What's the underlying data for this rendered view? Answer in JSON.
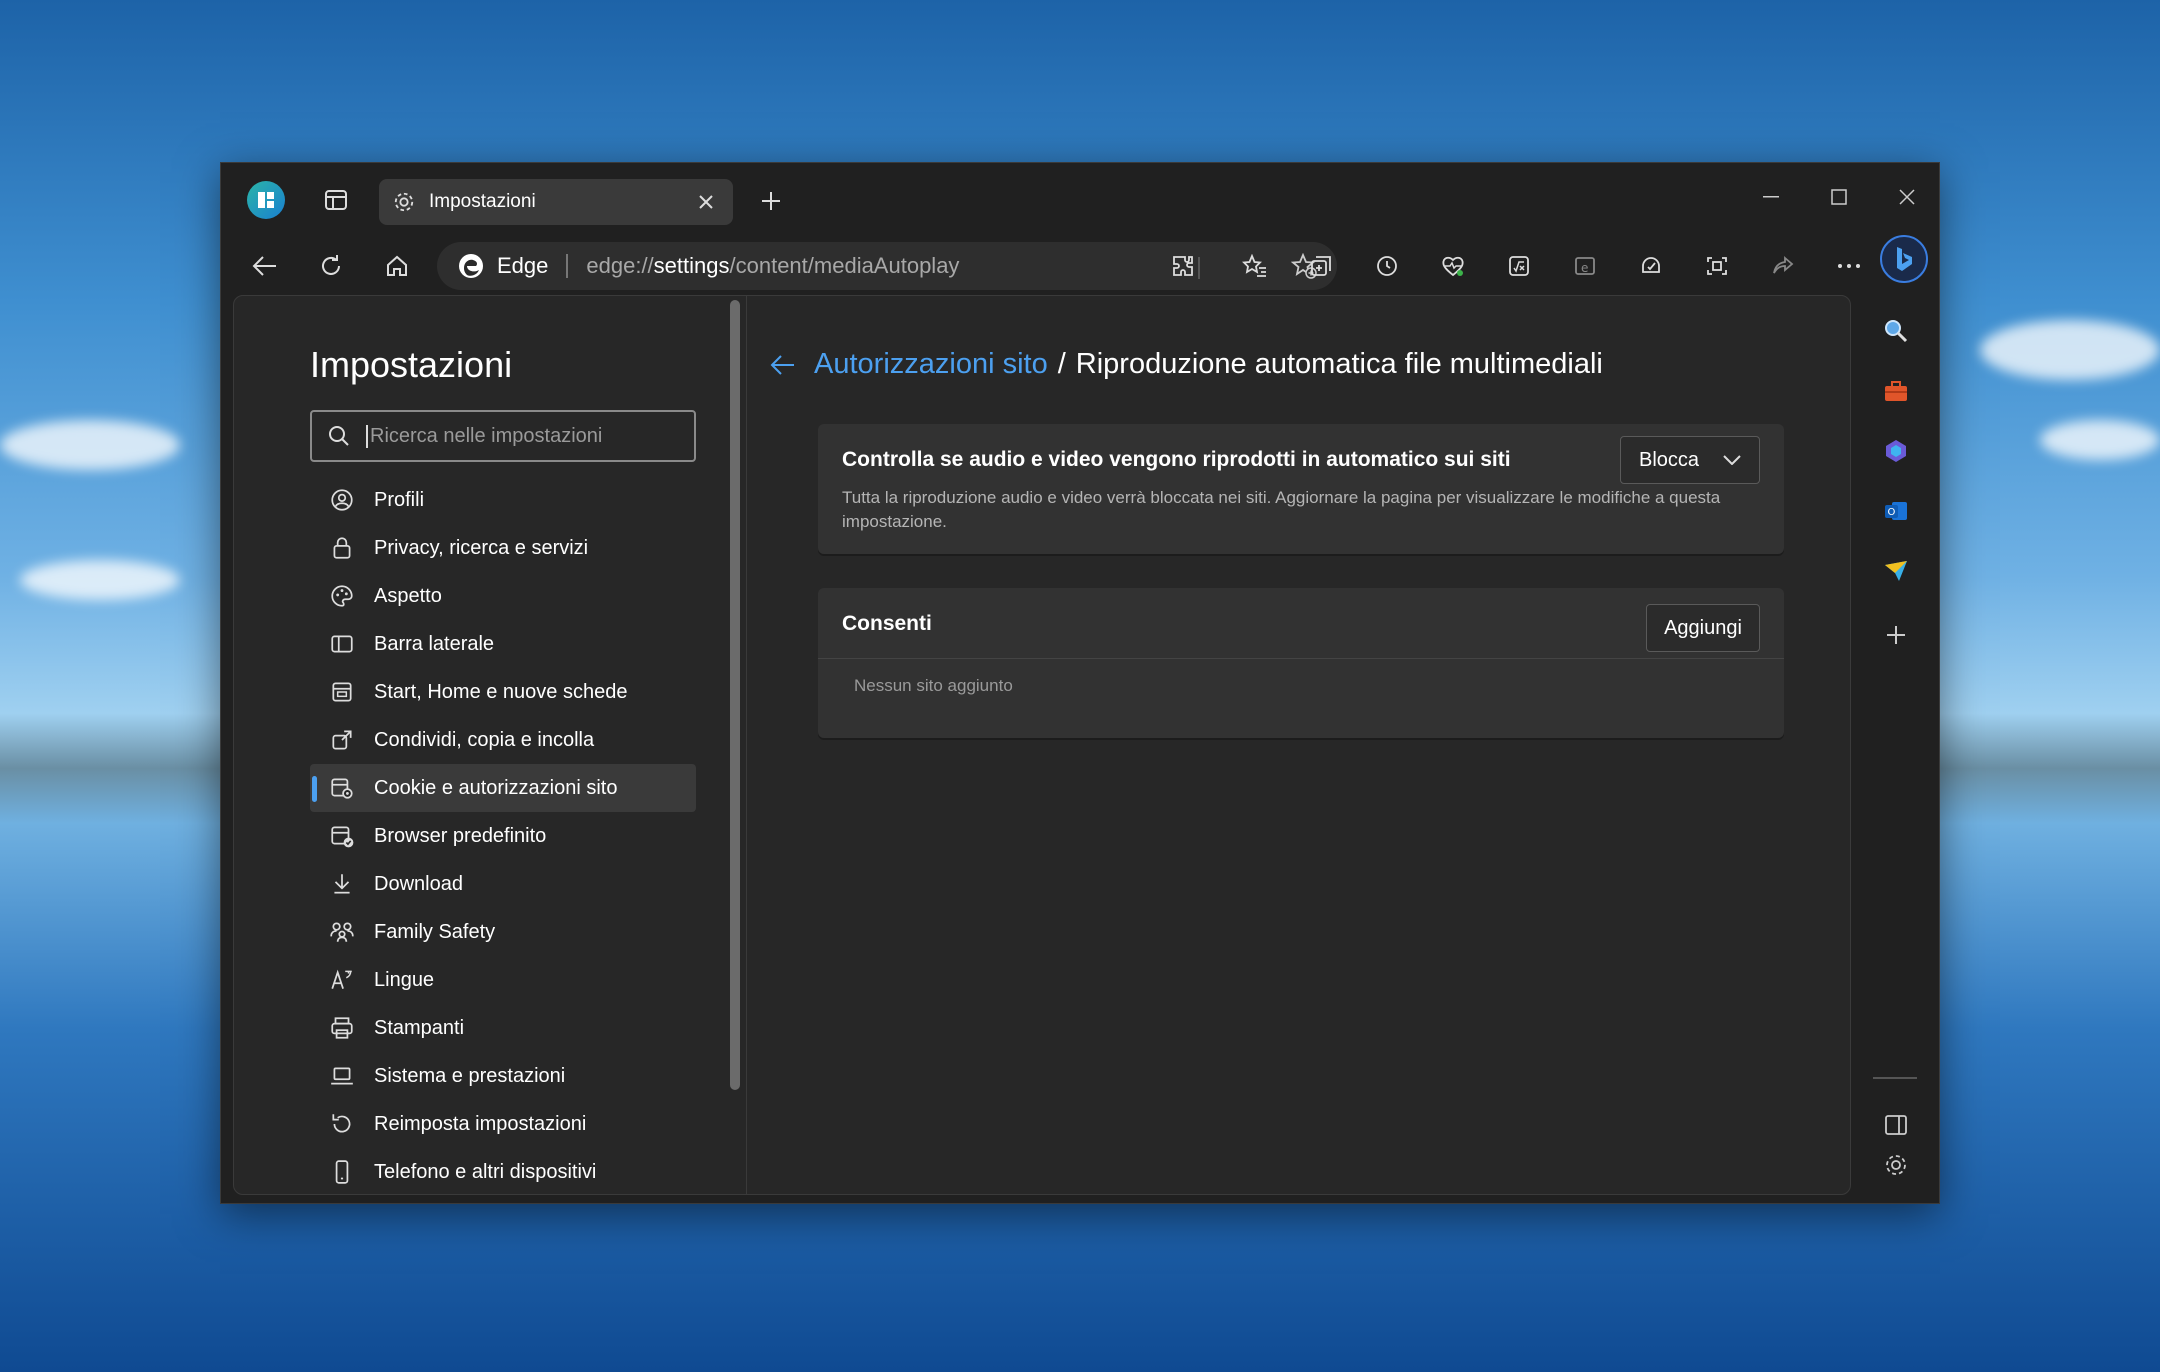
{
  "browser": {
    "tab_title": "Impostazioni",
    "address": {
      "brand": "Edge",
      "url_prefix": "edge://",
      "url_host": "settings",
      "url_path": "/content/mediaAutoplay"
    }
  },
  "settings": {
    "title": "Impostazioni",
    "search_placeholder": "Ricerca nelle impostazioni",
    "nav": [
      {
        "label": "Profili",
        "icon": "profile-icon"
      },
      {
        "label": "Privacy, ricerca e servizi",
        "icon": "lock-icon"
      },
      {
        "label": "Aspetto",
        "icon": "palette-icon"
      },
      {
        "label": "Barra laterale",
        "icon": "sidebar-icon"
      },
      {
        "label": "Start, Home e nuove schede",
        "icon": "home-tabs-icon"
      },
      {
        "label": "Condividi, copia e incolla",
        "icon": "share-icon"
      },
      {
        "label": "Cookie e autorizzazioni sito",
        "icon": "cookie-permissions-icon",
        "active": true
      },
      {
        "label": "Browser predefinito",
        "icon": "default-browser-icon"
      },
      {
        "label": "Download",
        "icon": "download-icon"
      },
      {
        "label": "Family Safety",
        "icon": "family-icon"
      },
      {
        "label": "Lingue",
        "icon": "language-icon"
      },
      {
        "label": "Stampanti",
        "icon": "printer-icon"
      },
      {
        "label": "Sistema e prestazioni",
        "icon": "laptop-icon"
      },
      {
        "label": "Reimposta impostazioni",
        "icon": "reset-icon"
      },
      {
        "label": "Telefono e altri dispositivi",
        "icon": "phone-icon"
      }
    ]
  },
  "page": {
    "breadcrumb_parent": "Autorizzazioni sito",
    "breadcrumb_separator": "/",
    "breadcrumb_current": "Riproduzione automatica file multimediali",
    "autoplay_card": {
      "title": "Controlla se audio e video vengono riprodotti in automatico sui siti",
      "description": "Tutta la riproduzione audio e video verrà bloccata nei siti. Aggiornare la pagina per visualizzare le modifiche a questa impostazione.",
      "dropdown_value": "Blocca"
    },
    "allow_card": {
      "title": "Consenti",
      "add_label": "Aggiungi",
      "empty_text": "Nessun sito aggiunto"
    }
  },
  "colors": {
    "accent": "#4ca0f0",
    "window_bg": "#202020",
    "content_bg": "#272727",
    "card_bg": "#323232"
  }
}
